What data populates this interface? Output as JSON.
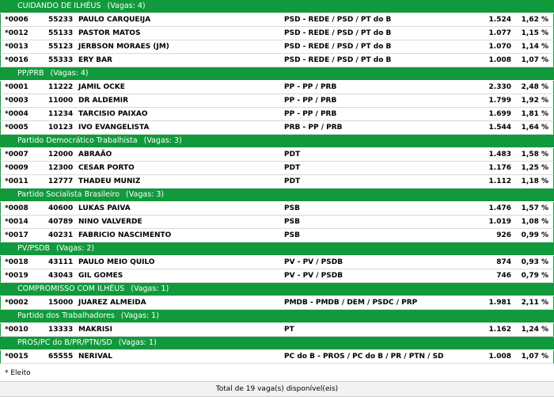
{
  "groups": [
    {
      "name": "CUIDANDO DE ILHÉUS",
      "vagas": "(Vagas: 4)",
      "rows": [
        {
          "code": "*0006",
          "num": "55233",
          "name": "PAULO CARQUEIJA",
          "party": "PSD - REDE / PSD / PT do B",
          "votes": "1.524",
          "pct": "1,62 %"
        },
        {
          "code": "*0012",
          "num": "55133",
          "name": "PASTOR MATOS",
          "party": "PSD - REDE / PSD / PT do B",
          "votes": "1.077",
          "pct": "1,15 %"
        },
        {
          "code": "*0013",
          "num": "55123",
          "name": "JERBSON MORAES (JM)",
          "party": "PSD - REDE / PSD / PT do B",
          "votes": "1.070",
          "pct": "1,14 %"
        },
        {
          "code": "*0016",
          "num": "55333",
          "name": "ERY BAR",
          "party": "PSD - REDE / PSD / PT do B",
          "votes": "1.008",
          "pct": "1,07 %"
        }
      ]
    },
    {
      "name": "PP/PRB",
      "vagas": "(Vagas: 4)",
      "rows": [
        {
          "code": "*0001",
          "num": "11222",
          "name": "JAMIL OCKE",
          "party": "PP - PP / PRB",
          "votes": "2.330",
          "pct": "2,48 %"
        },
        {
          "code": "*0003",
          "num": "11000",
          "name": "DR ALDEMIR",
          "party": "PP - PP / PRB",
          "votes": "1.799",
          "pct": "1,92 %"
        },
        {
          "code": "*0004",
          "num": "11234",
          "name": "TARCISIO PAIXAO",
          "party": "PP - PP / PRB",
          "votes": "1.699",
          "pct": "1,81 %"
        },
        {
          "code": "*0005",
          "num": "10123",
          "name": "IVO EVANGELISTA",
          "party": "PRB - PP / PRB",
          "votes": "1.544",
          "pct": "1,64 %"
        }
      ]
    },
    {
      "name": "Partido Democrático Trabalhista",
      "vagas": "(Vagas: 3)",
      "rows": [
        {
          "code": "*0007",
          "num": "12000",
          "name": "ABRAÃO",
          "party": "PDT",
          "votes": "1.483",
          "pct": "1,58 %"
        },
        {
          "code": "*0009",
          "num": "12300",
          "name": "CESAR PORTO",
          "party": "PDT",
          "votes": "1.176",
          "pct": "1,25 %"
        },
        {
          "code": "*0011",
          "num": "12777",
          "name": "THADEU MUNIZ",
          "party": "PDT",
          "votes": "1.112",
          "pct": "1,18 %"
        }
      ]
    },
    {
      "name": "Partido Socialista Brasileiro",
      "vagas": "(Vagas: 3)",
      "rows": [
        {
          "code": "*0008",
          "num": "40600",
          "name": "LUKAS PAIVA",
          "party": "PSB",
          "votes": "1.476",
          "pct": "1,57 %"
        },
        {
          "code": "*0014",
          "num": "40789",
          "name": "NINO VALVERDE",
          "party": "PSB",
          "votes": "1.019",
          "pct": "1,08 %"
        },
        {
          "code": "*0017",
          "num": "40231",
          "name": "FABRICIO NASCIMENTO",
          "party": "PSB",
          "votes": "926",
          "pct": "0,99 %"
        }
      ]
    },
    {
      "name": "PV/PSDB",
      "vagas": "(Vagas: 2)",
      "rows": [
        {
          "code": "*0018",
          "num": "43111",
          "name": "PAULO MEIO QUILO",
          "party": "PV - PV / PSDB",
          "votes": "874",
          "pct": "0,93 %"
        },
        {
          "code": "*0019",
          "num": "43043",
          "name": "GIL GOMES",
          "party": "PV - PV / PSDB",
          "votes": "746",
          "pct": "0,79 %"
        }
      ]
    },
    {
      "name": "COMPROMISSO COM ILHÉUS",
      "vagas": "(Vagas: 1)",
      "rows": [
        {
          "code": "*0002",
          "num": "15000",
          "name": "JUAREZ ALMEIDA",
          "party": "PMDB - PMDB / DEM / PSDC / PRP",
          "votes": "1.981",
          "pct": "2,11 %"
        }
      ]
    },
    {
      "name": "Partido dos Trabalhadores",
      "vagas": "(Vagas: 1)",
      "rows": [
        {
          "code": "*0010",
          "num": "13333",
          "name": "MAKRISI",
          "party": "PT",
          "votes": "1.162",
          "pct": "1,24 %"
        }
      ]
    },
    {
      "name": "PROS/PC do B/PR/PTN/SD",
      "vagas": "(Vagas: 1)",
      "rows": [
        {
          "code": "*0015",
          "num": "65555",
          "name": "NERIVAL",
          "party": "PC do B - PROS / PC do B / PR / PTN / SD",
          "votes": "1.008",
          "pct": "1,07 %"
        }
      ]
    }
  ],
  "legend": "* Eleito",
  "total": "Total de 19 vaga(s) disponível(eis)",
  "colors": {
    "header_green": "#119a3c"
  }
}
